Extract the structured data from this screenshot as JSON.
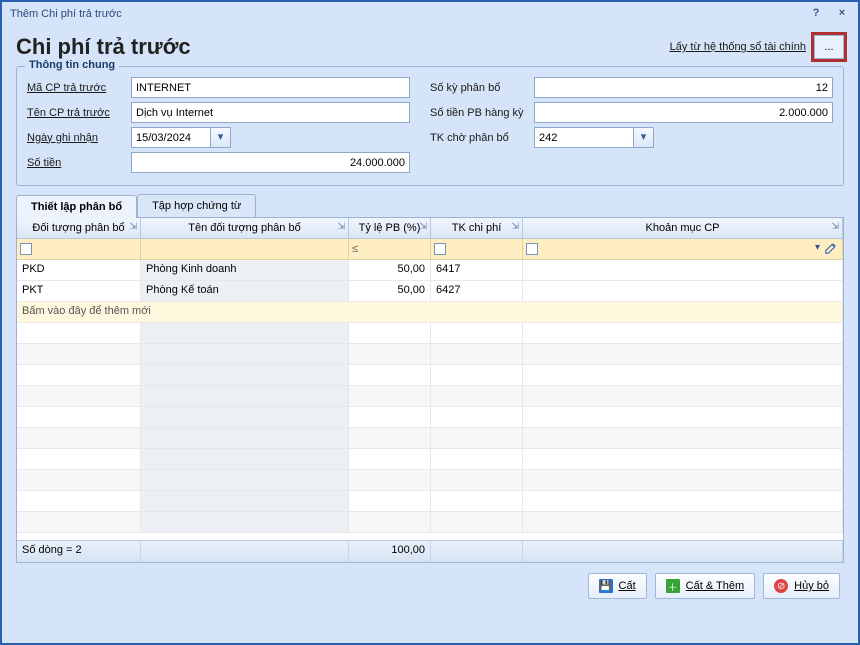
{
  "window_title": "Thêm Chi phí trả trước",
  "page_title": "Chi phí trả trước",
  "link_from_finance": "Lấy từ hệ thống sổ tài chính",
  "more_btn_label": "...",
  "fieldset_legend": "Thông tin chung",
  "labels": {
    "ma_cp": "Mã CP trả trước",
    "ten_cp": "Tên CP trả trước",
    "ngay_ghi_nhan": "Ngày ghi nhận",
    "so_tien": "Số tiền",
    "so_ky": "Số kỳ phân bổ",
    "so_tien_pb": "Số tiền PB hàng kỳ",
    "tk_cho": "TK chờ phân bổ"
  },
  "values": {
    "ma_cp": "INTERNET",
    "ten_cp": "Dịch vụ Internet",
    "ngay_ghi_nhan": "15/03/2024",
    "so_tien": "24.000.000",
    "so_ky": "12",
    "so_tien_pb": "2.000.000",
    "tk_cho": "242"
  },
  "tabs": {
    "tab1": "Thiết lập phân bổ",
    "tab2": "Tập hợp chứng từ"
  },
  "grid_headers": {
    "doi_tuong": "Đối tượng phân bổ",
    "ten_dt": "Tên đối tượng phân bổ",
    "tyle": "Tỷ lệ PB (%)",
    "tk_cp": "TK chi phí",
    "khoan_muc": "Khoản mục CP"
  },
  "filter_op": "≤",
  "rows": [
    {
      "dt": "PKD",
      "ten": "Phòng Kinh doanh",
      "tyle": "50,00",
      "tk": "6417",
      "km": ""
    },
    {
      "dt": "PKT",
      "ten": "Phòng Kế toán",
      "tyle": "50,00",
      "tk": "6427",
      "km": ""
    }
  ],
  "addrow_hint": "Bấm vào đây để thêm mới",
  "footer": {
    "so_dong": "Số dòng = 2",
    "tong_tyle": "100,00"
  },
  "buttons": {
    "cat": "Cất",
    "cat_them": "Cất & Thêm",
    "huy": "Hủy bỏ"
  }
}
